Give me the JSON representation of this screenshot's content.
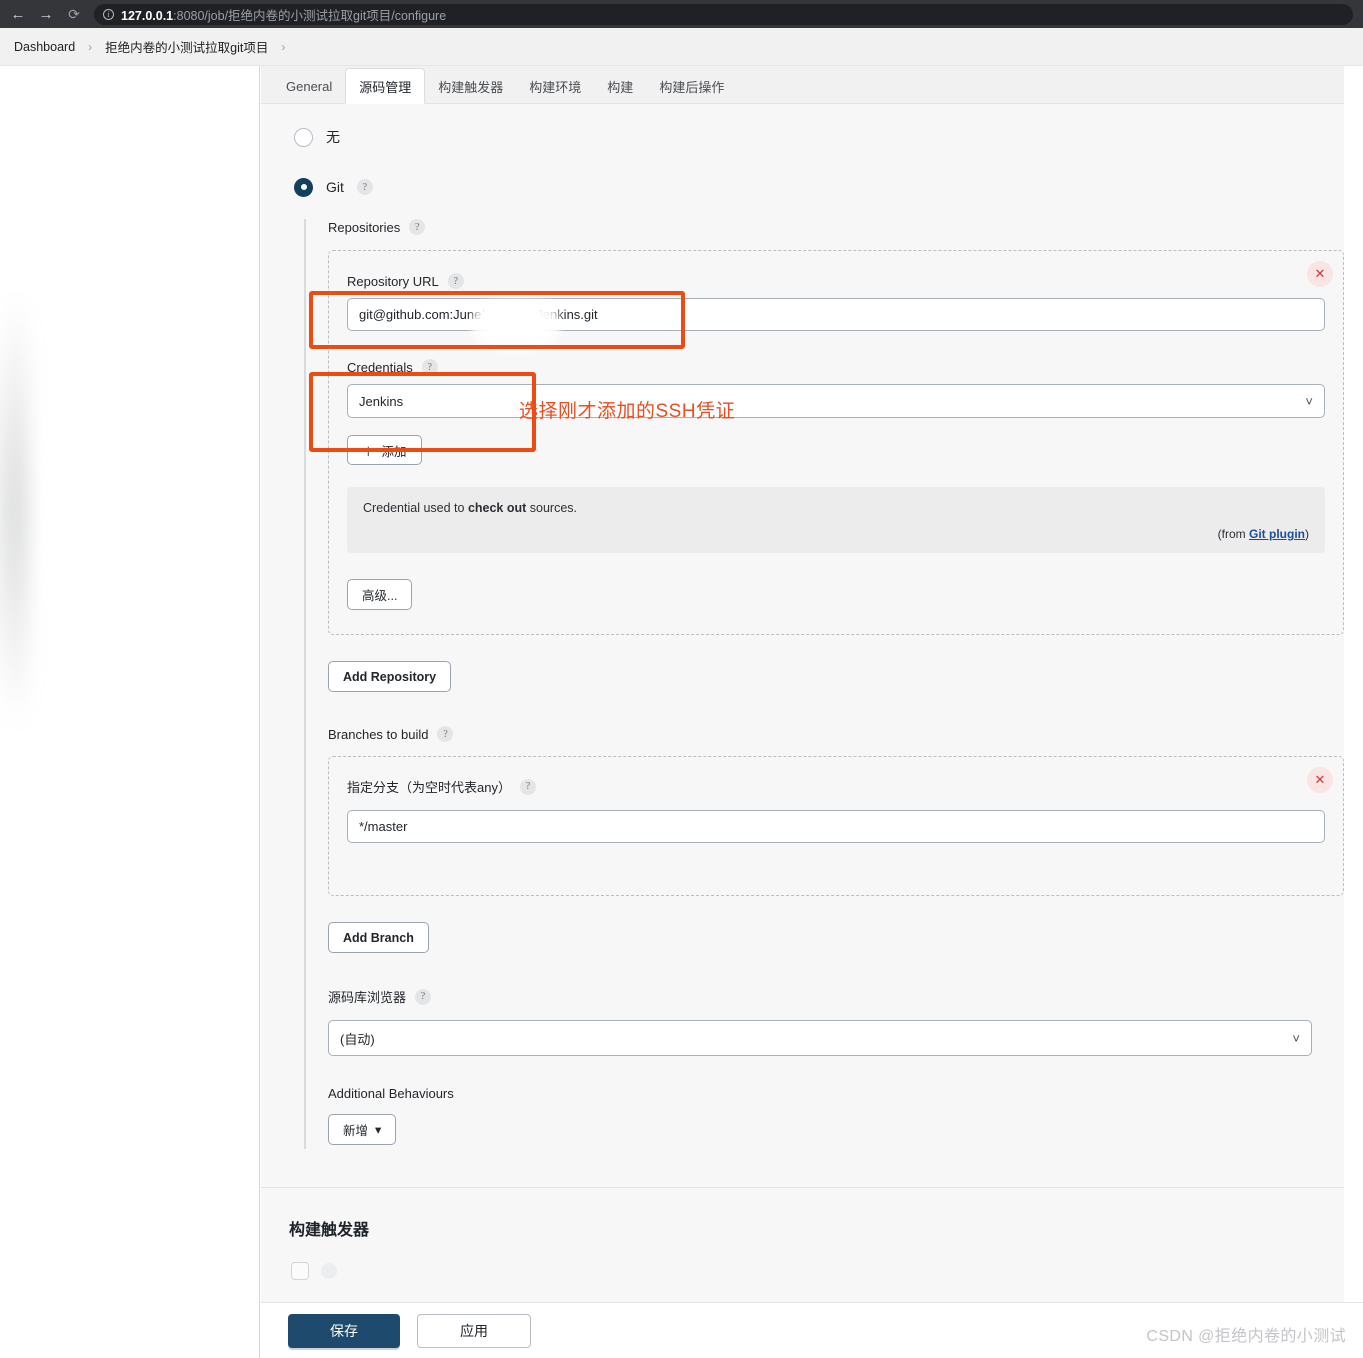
{
  "browser": {
    "back_icon": "back-arrow-icon",
    "forward_icon": "forward-arrow-icon",
    "reload_icon": "reload-icon",
    "url_host": "127.0.0.1",
    "url_rest": ":8080/job/拒绝内卷的小测试拉取git项目/configure"
  },
  "breadcrumb": {
    "items": [
      "Dashboard",
      "拒绝内卷的小测试拉取git项目"
    ],
    "separator": "›"
  },
  "tabs": [
    {
      "label": "General",
      "active": false
    },
    {
      "label": "源码管理",
      "active": true
    },
    {
      "label": "构建触发器",
      "active": false
    },
    {
      "label": "构建环境",
      "active": false
    },
    {
      "label": "构建",
      "active": false
    },
    {
      "label": "构建后操作",
      "active": false
    }
  ],
  "scm": {
    "option_none": "无",
    "option_git": "Git",
    "help_glyph": "?",
    "repositories_label": "Repositories",
    "repository_url_label": "Repository URL",
    "repository_url_value": "git@github.com:Juneˈ            _Jenkins.git",
    "credentials_label": "Credentials",
    "credentials_value": "Jenkins",
    "add_credentials_button": "添加",
    "add_credentials_icon": "plus-icon",
    "credential_note_pre": "Credential used to ",
    "credential_note_bold": "check out",
    "credential_note_post": " sources.",
    "from_prefix": "(from ",
    "from_link": "Git plugin",
    "from_suffix": ")",
    "advanced_button": "高级...",
    "add_repository_button": "Add Repository",
    "branches_label": "Branches to build",
    "branch_spec_label": "指定分支（为空时代表any）",
    "branch_spec_value": "*/master",
    "add_branch_button": "Add Branch",
    "browser_label": "源码库浏览器",
    "browser_value": "(自动)",
    "additional_behaviours_label": "Additional Behaviours",
    "add_behaviour_button": "新增",
    "add_behaviour_caret": "▾",
    "delete_icon": "close-x-icon",
    "chevron_icon": "chevron-down-icon"
  },
  "triggers": {
    "section_title": "构建触发器"
  },
  "footer": {
    "save_button": "保存",
    "apply_button": "应用",
    "watermark": "CSDN @拒绝内卷的小测试"
  },
  "annotations": {
    "ssh_hint": "选择刚才添加的SSH凭证",
    "highlight_color": "#ed4a14",
    "accent_color": "#1d4a6d"
  }
}
